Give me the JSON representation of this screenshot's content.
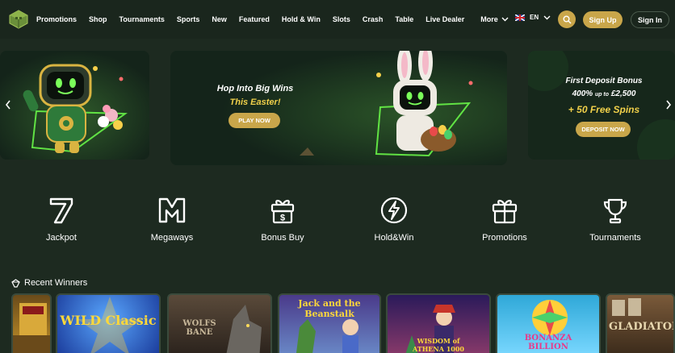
{
  "header": {
    "nav": [
      "Promotions",
      "Shop",
      "Tournaments",
      "Sports",
      "New",
      "Featured",
      "Hold & Win",
      "Slots",
      "Crash",
      "Table",
      "Live Dealer"
    ],
    "more_label": "More",
    "language": "EN",
    "signup_label": "Sign Up",
    "signin_label": "Sign In"
  },
  "banners": {
    "main": {
      "title": "Hop Into Big Wins",
      "subtitle": "This Easter!",
      "cta": "PLAY NOW"
    },
    "right": {
      "title": "First Deposit Bonus",
      "line2_main": "400%",
      "line2_small": "up to",
      "line2_amount": "£2,500",
      "line3": "+ 50 Free Spins",
      "cta": "DEPOSIT NOW"
    }
  },
  "categories": [
    {
      "label": "Jackpot",
      "icon": "seven-icon"
    },
    {
      "label": "Megaways",
      "icon": "megaways-m-icon"
    },
    {
      "label": "Bonus Buy",
      "icon": "bonus-buy-gift-icon"
    },
    {
      "label": "Hold&Win",
      "icon": "lightning-icon"
    },
    {
      "label": "Promotions",
      "icon": "gift-icon"
    },
    {
      "label": "Tournaments",
      "icon": "trophy-icon"
    }
  ],
  "recent_winners": {
    "title": "Recent Winners",
    "games": [
      {
        "name": "WILD Classic"
      },
      {
        "name": "WOLFS BANE"
      },
      {
        "name": "Jack and the Beanstalk"
      },
      {
        "name": "WISDOM of ATHENA 1000"
      },
      {
        "name": "BONANZA BILLION"
      },
      {
        "name": "GLADIATOR"
      }
    ]
  },
  "colors": {
    "background": "#1d2a20",
    "header": "#1a261d",
    "accent_gold": "#c9a64a",
    "highlight_yellow": "#f0d04a"
  }
}
